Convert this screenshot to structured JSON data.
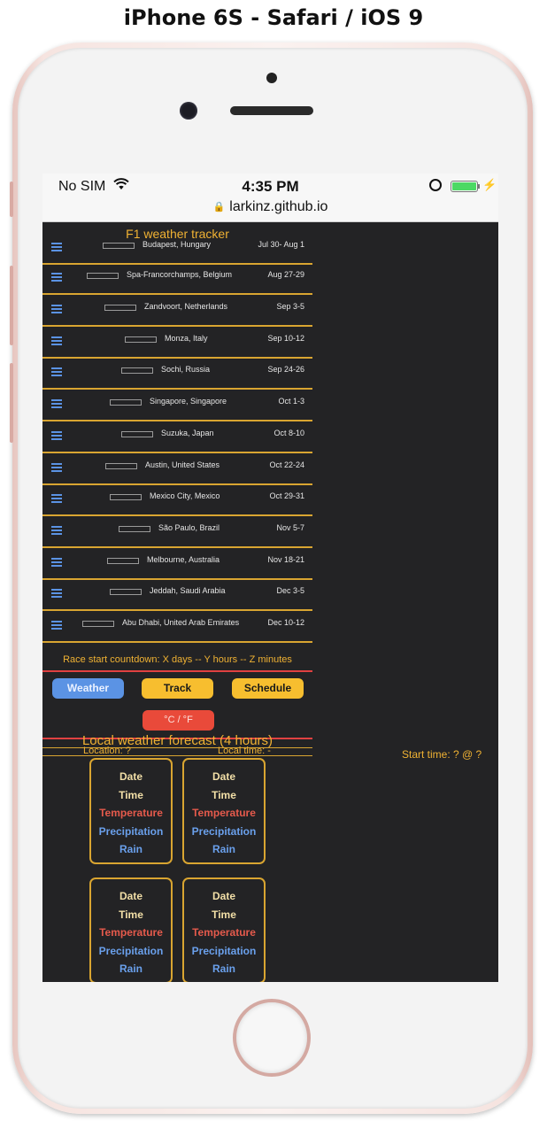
{
  "device_caption": "iPhone 6S - Safari / iOS 9",
  "status_bar": {
    "carrier": "No SIM",
    "time": "4:35 PM",
    "url": "larkinz.github.io",
    "battery_color": "#4cd964"
  },
  "app": {
    "title": "F1 weather tracker",
    "races": [
      {
        "location": "Budapest, Hungary",
        "dates": "Jul 30- Aug 1"
      },
      {
        "location": "Spa-Francorchamps, Belgium",
        "dates": "Aug 27-29"
      },
      {
        "location": "Zandvoort, Netherlands",
        "dates": "Sep 3-5"
      },
      {
        "location": "Monza, Italy",
        "dates": "Sep 10-12"
      },
      {
        "location": "Sochi, Russia",
        "dates": "Sep 24-26"
      },
      {
        "location": "Singapore, Singapore",
        "dates": "Oct 1-3"
      },
      {
        "location": "Suzuka, Japan",
        "dates": "Oct 8-10"
      },
      {
        "location": "Austin, United States",
        "dates": "Oct 22-24"
      },
      {
        "location": "Mexico City, Mexico",
        "dates": "Oct 29-31"
      },
      {
        "location": "São Paulo, Brazil",
        "dates": "Nov 5-7"
      },
      {
        "location": "Melbourne, Australia",
        "dates": "Nov 18-21"
      },
      {
        "location": "Jeddah, Saudi Arabia",
        "dates": "Dec 3-5"
      },
      {
        "location": "Abu Dhabi, United Arab Emirates",
        "dates": "Dec 10-12"
      }
    ],
    "countdown": "Race start countdown: X days -- Y hours -- Z minutes",
    "buttons": {
      "weather": "Weather",
      "track": "Track",
      "schedule": "Schedule",
      "unit_toggle": "°C / °F"
    },
    "forecast": {
      "title": "Local weather forecast (4 hours)",
      "location": "Location: ?",
      "local_time": "Local time: -",
      "start_time": "Start time: ? @ ?",
      "cards": [
        {
          "date": "Date",
          "time": "Time",
          "temperature": "Temperature",
          "precipitation": "Precipitation",
          "rain": "Rain"
        },
        {
          "date": "Date",
          "time": "Time",
          "temperature": "Temperature",
          "precipitation": "Precipitation",
          "rain": "Rain"
        },
        {
          "date": "Date",
          "time": "Time",
          "temperature": "Temperature",
          "precipitation": "Precipitation",
          "rain": "Rain"
        },
        {
          "date": "Date",
          "time": "Time",
          "temperature": "Temperature",
          "precipitation": "Precipitation",
          "rain": "Rain"
        }
      ]
    }
  },
  "colors": {
    "accent_gold": "#f0b233",
    "button_blue": "#5b93e4",
    "button_yellow": "#f7be2f",
    "button_red": "#e94a3a",
    "background": "#232325"
  }
}
